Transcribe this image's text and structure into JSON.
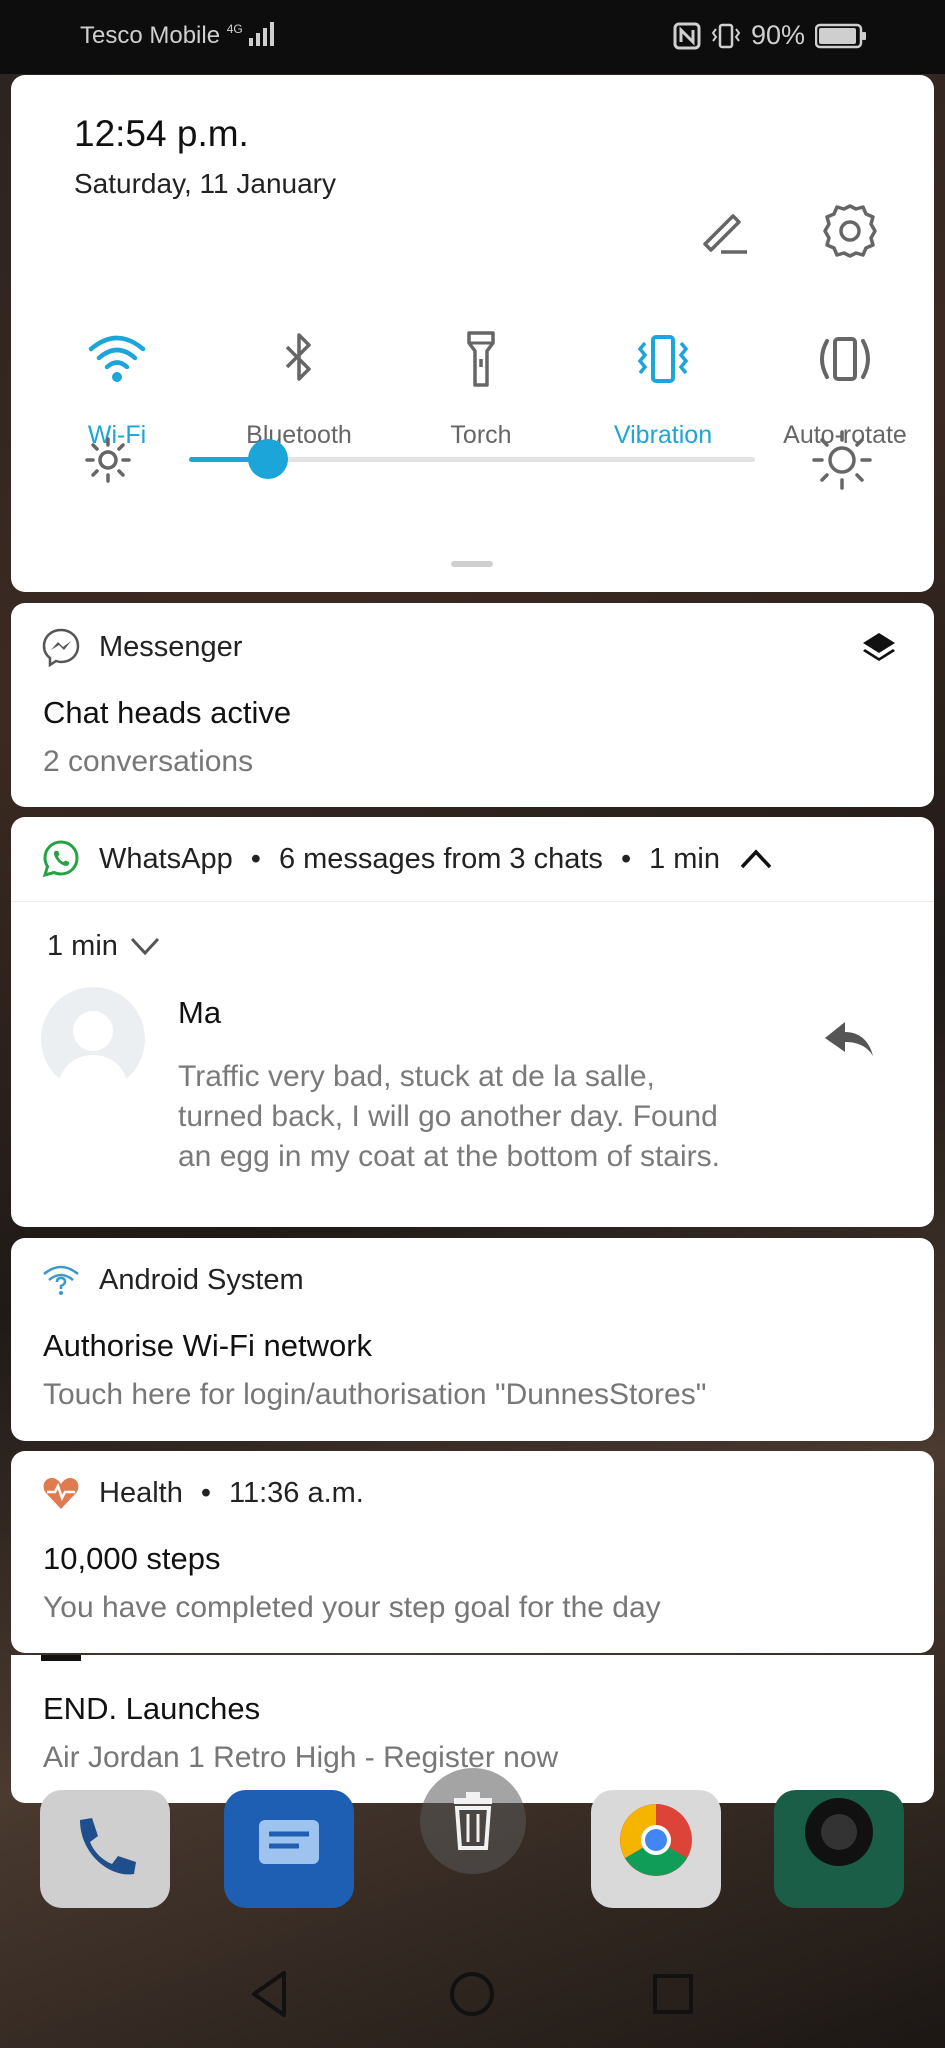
{
  "status_bar": {
    "carrier": "Tesco Mobile",
    "network": "4G",
    "battery": "90%"
  },
  "quick_settings": {
    "time": "12:54 p.m.",
    "date": "Saturday, 11 January",
    "tiles": [
      {
        "label": "Wi-Fi",
        "icon": "wifi-icon",
        "active": true
      },
      {
        "label": "Bluetooth",
        "icon": "bluetooth-icon",
        "active": false
      },
      {
        "label": "Torch",
        "icon": "torch-icon",
        "active": false
      },
      {
        "label": "Vibration",
        "icon": "vibration-icon",
        "active": true
      },
      {
        "label": "Auto-rotate",
        "icon": "auto-rotate-icon",
        "active": false
      }
    ],
    "brightness_level": 0.14,
    "accent_color": "#1ca5d8"
  },
  "notifications": {
    "messenger": {
      "app": "Messenger",
      "title": "Chat heads active",
      "text": "2 conversations"
    },
    "whatsapp": {
      "app": "WhatsApp",
      "summary": "6 messages from 3 chats",
      "time": "1 min",
      "group_time": "1 min",
      "sender": "Ma",
      "message": "Traffic very bad, stuck at de la salle, turned back, I will go another day. Found an egg in my coat at the bottom of stairs."
    },
    "android": {
      "app": "Android System",
      "title": "Authorise Wi-Fi network",
      "text": "Touch here for login/authorisation \"DunnesStores\""
    },
    "health": {
      "app": "Health",
      "time": "11:36 a.m.",
      "title": "10,000 steps",
      "text": "You have completed your step goal for the day"
    },
    "end": {
      "title": "END. Launches",
      "text": "Air Jordan 1 Retro High  - Register now"
    }
  }
}
